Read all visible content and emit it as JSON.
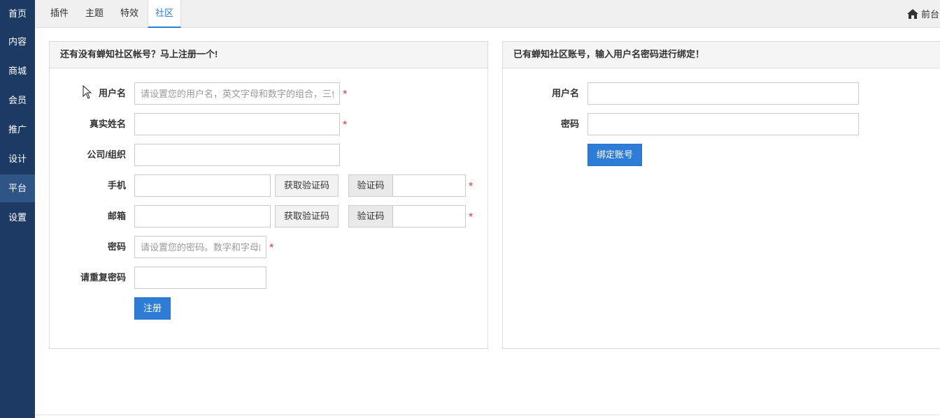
{
  "sidebar": {
    "items": [
      {
        "label": "首页"
      },
      {
        "label": "内容"
      },
      {
        "label": "商城"
      },
      {
        "label": "会员"
      },
      {
        "label": "推广"
      },
      {
        "label": "设计"
      },
      {
        "label": "平台"
      },
      {
        "label": "设置"
      }
    ],
    "active": "平台"
  },
  "topbar": {
    "tabs": [
      {
        "label": "插件"
      },
      {
        "label": "主题"
      },
      {
        "label": "特效"
      },
      {
        "label": "社区"
      }
    ],
    "active_tab": "社区",
    "front_label": "前台",
    "front_icon": "home-icon"
  },
  "register": {
    "title": "还有没有蝉知社区帐号？马上注册一个!",
    "username_label": "用户名",
    "username_placeholder": "请设置您的用户名，英文字母和数字的组合，三位以上",
    "realname_label": "真实姓名",
    "company_label": "公司/组织",
    "phone_label": "手机",
    "email_label": "邮箱",
    "get_code_label": "获取验证码",
    "code_label": "验证码",
    "password_label": "密码",
    "password_placeholder": "请设置您的密码。数字和字母的组合",
    "repeat_password_label": "请重复密码",
    "submit_label": "注册",
    "required_mark": "*"
  },
  "bind": {
    "title": "已有蝉知社区账号，输入用户名密码进行绑定！",
    "username_label": "用户名",
    "password_label": "密码",
    "submit_label": "绑定账号"
  },
  "colors": {
    "sidebar_bg": "#1c3a63",
    "sidebar_active": "#2f5486",
    "accent": "#2d7cd8",
    "required": "#e33333"
  }
}
